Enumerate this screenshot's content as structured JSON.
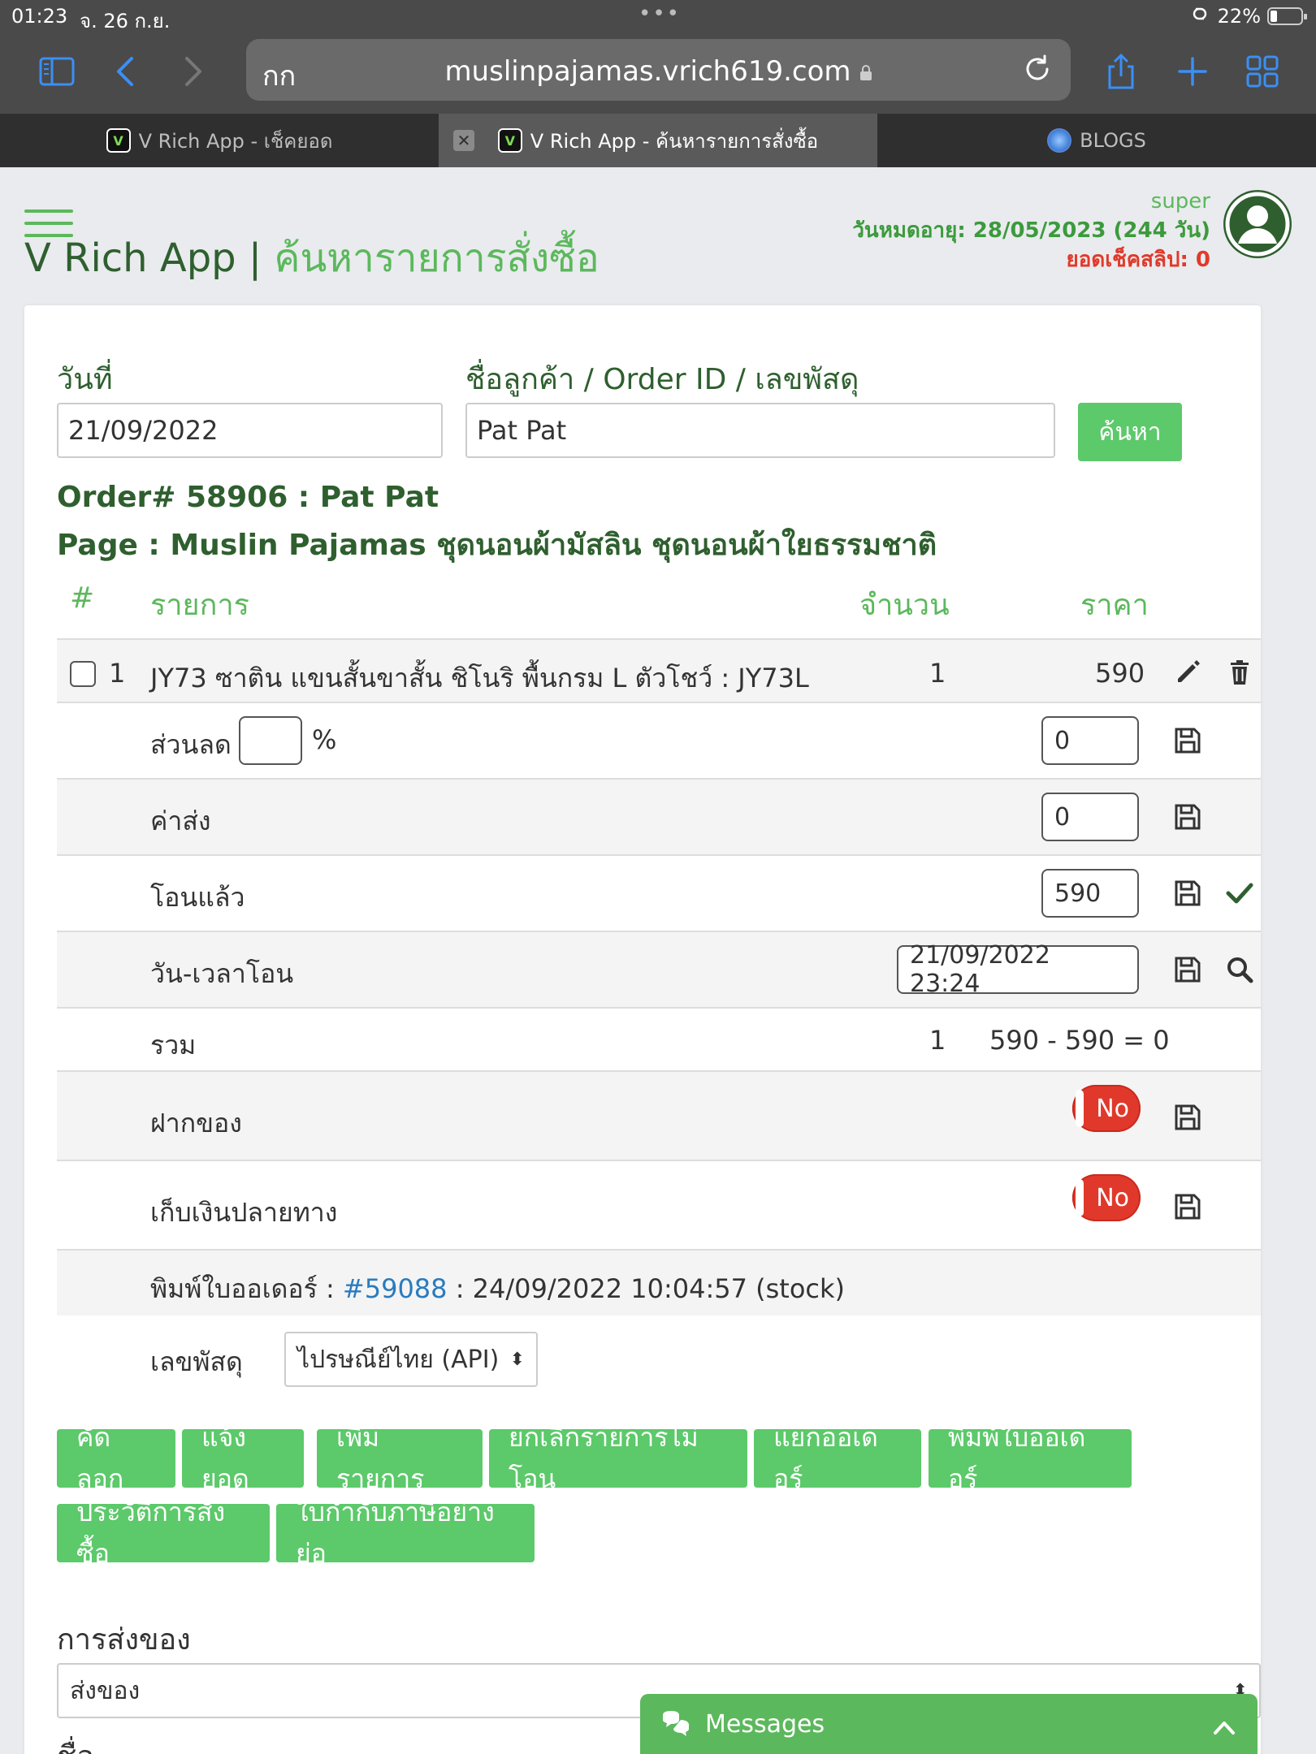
{
  "status": {
    "time": "01:23",
    "date": "จ. 26 ก.ย.",
    "battery": "22%"
  },
  "browser": {
    "aa": "กก",
    "url": "muslinpajamas.vrich619.com",
    "tabs": [
      {
        "label": "V Rich App - เช็คยอด"
      },
      {
        "label": "V Rich App - ค้นหารายการสั่งซื้อ"
      },
      {
        "label": "BLOGS"
      }
    ]
  },
  "header": {
    "brand": "V Rich App |",
    "subtitle": "ค้นหารายการสั่งซื้อ",
    "user": "super",
    "expiry": "วันหมดอายุ: 28/05/2023 (244 วัน)",
    "slip": "ยอดเช็คสลิป: 0"
  },
  "search": {
    "date_label": "วันที่",
    "date_value": "21/09/2022",
    "query_label": "ชื่อลูกค้า / Order ID / เลขพัสดุ",
    "query_value": "Pat Pat",
    "button": "ค้นหา"
  },
  "order": {
    "title": "Order# 58906 : Pat Pat",
    "page": "Page : Muslin Pajamas ชุดนอนผ้ามัสลิน ชุดนอนผ้าใยธรรมชาติ"
  },
  "table": {
    "headers": {
      "num": "#",
      "item": "รายการ",
      "qty": "จำนวน",
      "price": "ราคา"
    },
    "item": {
      "num": "1",
      "name": "JY73 ซาติน แขนสั้นขาสั้น ชิโนริ พื้นกรม L ตัวโชว์ : JY73L",
      "qty": "1",
      "price": "590"
    },
    "discount": {
      "label": "ส่วนลด",
      "percent_value": "",
      "percent_sign": "%",
      "value": "0"
    },
    "shipping": {
      "label": "ค่าส่ง",
      "value": "0"
    },
    "paid": {
      "label": "โอนแล้ว",
      "value": "590"
    },
    "paid_time": {
      "label": "วัน-เวลาโอน",
      "value": "21/09/2022 23:24"
    },
    "total": {
      "label": "รวม",
      "qty": "1",
      "value": "590 - 590 = 0"
    },
    "deposit": {
      "label": "ฝากของ",
      "toggle": "No"
    },
    "cod": {
      "label": "เก็บเงินปลายทาง",
      "toggle": "No"
    },
    "print": {
      "prefix": "พิมพ์ใบออเดอร์ : ",
      "link": "#59088",
      "suffix": " : 24/09/2022 10:04:57 (stock)"
    },
    "tracking": {
      "label": "เลขพัสดุ",
      "value": "ไปรษณีย์ไทย (API)"
    }
  },
  "actions": [
    "คัดลอก",
    "แจ้งยอด",
    "เพิ่มรายการ",
    "ยกเลิกรายการไม่โอน",
    "แยกออเดอร์",
    "พิมพ์ใบออเดอร์",
    "ประวัติการสั่งซื้อ",
    "ใบกำกับภาษีอย่างย่อ"
  ],
  "delivery": {
    "label": "การส่งของ",
    "value": "ส่งของ",
    "next_label": "ชื่อ"
  },
  "messages": {
    "label": "Messages"
  },
  "colors": {
    "accent_green": "#5cc96a",
    "dark_green": "#2f5f2f",
    "danger": "#e03a2a",
    "link": "#2a7bbf"
  }
}
